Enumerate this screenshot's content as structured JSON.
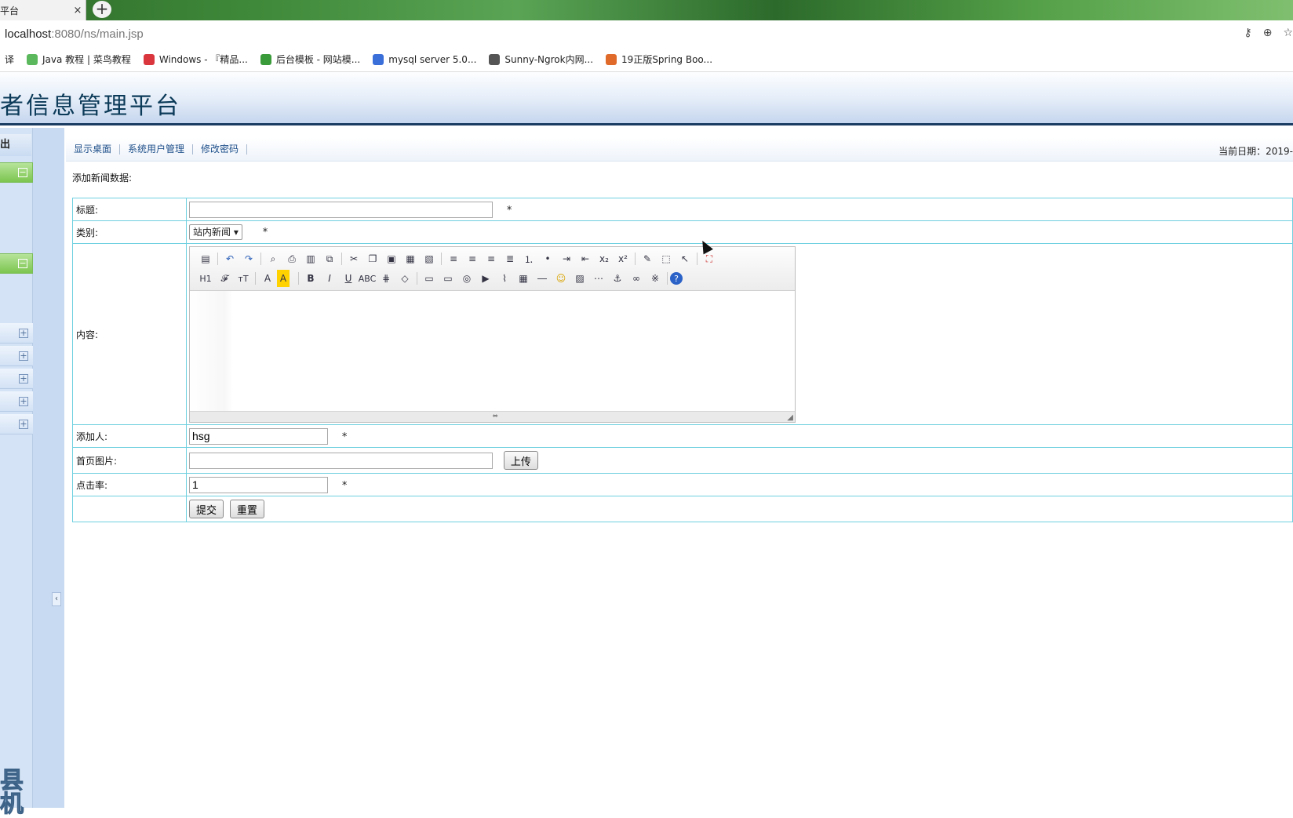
{
  "browser": {
    "tab_title": "平台",
    "tab_close": "×",
    "new_tab": "+",
    "url_host": "localhost",
    "url_path": ":8080/ns/main.jsp",
    "bookmarks": [
      {
        "label": "译",
        "color": "#ffffff"
      },
      {
        "label": "Java 教程 | 菜鸟教程",
        "color": "#5cb85c"
      },
      {
        "label": "Windows - 『精品...",
        "color": "#d9363e"
      },
      {
        "label": "后台模板 - 网站模...",
        "color": "#3a9b3a"
      },
      {
        "label": "mysql server 5.0...",
        "color": "#3a6ed9"
      },
      {
        "label": "Sunny-Ngrok内网...",
        "color": "#555555"
      },
      {
        "label": "19正版Spring Boo...",
        "color": "#e06a2a"
      }
    ]
  },
  "app": {
    "title": "者信息管理平台",
    "sidebar": {
      "logout": "出",
      "logo_text": "县\n机"
    },
    "nav": {
      "links": [
        "显示桌面",
        "系统用户管理",
        "修改密码"
      ],
      "date_label": "当前日期：2019-"
    },
    "section_title": "添加新闻数据:",
    "form": {
      "title_label": "标题:",
      "title_value": "",
      "category_label": "类别:",
      "category_value": "站内新闻",
      "content_label": "内容:",
      "author_label": "添加人:",
      "author_value": "hsg",
      "image_label": "首页图片:",
      "image_value": "",
      "upload_button": "上传",
      "clicks_label": "点击率:",
      "clicks_value": "1",
      "required_mark": "*",
      "submit_button": "提交",
      "reset_button": "重置"
    },
    "editor": {
      "row1_icons": [
        "source-icon",
        "undo-icon",
        "redo-icon",
        "preview-icon",
        "print-icon",
        "template-icon",
        "code-icon",
        "cut-icon",
        "copy-icon",
        "paste-icon",
        "paste-text-icon",
        "paste-word-icon",
        "align-left-icon",
        "align-center-icon",
        "align-right-icon",
        "justify-icon",
        "ordered-list-icon",
        "unordered-list-icon",
        "indent-icon",
        "outdent-icon",
        "subscript-icon",
        "superscript-icon",
        "clear-format-icon",
        "select-all-icon",
        "cursor-icon",
        "fullscreen-icon"
      ],
      "row2_icons": [
        "heading-icon",
        "font-family-icon",
        "font-size-icon",
        "font-color-icon",
        "highlight-icon",
        "bold-icon",
        "italic-icon",
        "underline-icon",
        "strikethrough-icon",
        "line-height-icon",
        "remove-format-icon",
        "image-icon",
        "multi-image-icon",
        "flash-icon",
        "media-icon",
        "attachment-icon",
        "table-icon",
        "hr-icon",
        "emoticon-icon",
        "map-icon",
        "pagebreak-icon",
        "anchor-icon",
        "link-icon",
        "unlink-icon",
        "help-icon"
      ]
    }
  }
}
